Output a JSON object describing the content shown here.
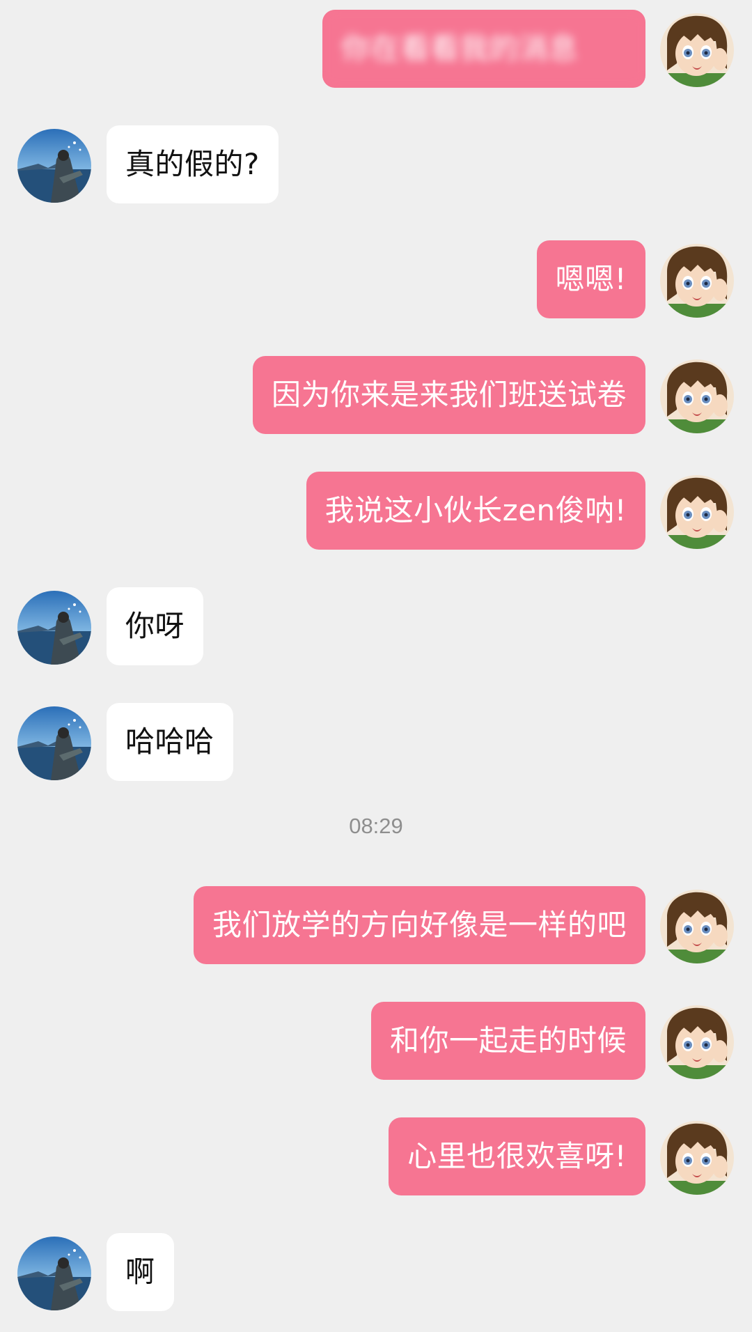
{
  "messages": [
    {
      "side": "out",
      "text": "你在看看我的消息"
    },
    {
      "side": "in",
      "text": "真的假的?"
    },
    {
      "side": "out",
      "text": "嗯嗯!"
    },
    {
      "side": "out",
      "text": "因为你来是来我们班送试卷"
    },
    {
      "side": "out",
      "text": "我说这小伙长zen俊呐!"
    },
    {
      "side": "in",
      "text": "你呀"
    },
    {
      "side": "in",
      "text": "哈哈哈"
    },
    {
      "side": "out",
      "text": "我们放学的方向好像是一样的吧"
    },
    {
      "side": "out",
      "text": "和你一起走的时候"
    },
    {
      "side": "out",
      "text": "心里也很欢喜呀!"
    },
    {
      "side": "in",
      "text": "啊"
    }
  ],
  "timestamp": "08:29",
  "colors": {
    "background": "#efefef",
    "outgoing_bubble": "#f67592",
    "incoming_bubble": "#ffffff",
    "timestamp_text": "#8e8e8e"
  },
  "icons": {
    "self_avatar": "anime-girl-avatar",
    "other_avatar": "seaside-person-avatar"
  }
}
